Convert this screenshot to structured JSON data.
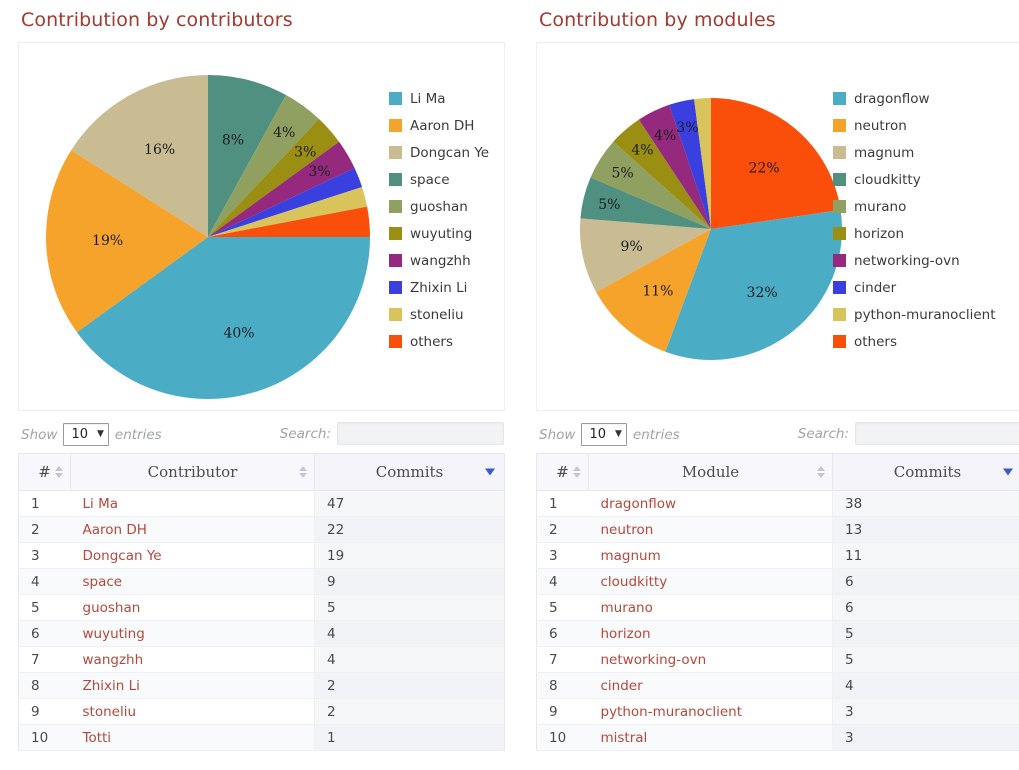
{
  "colors": {
    "title": "#a3392f",
    "link": "#b5483c",
    "sort_active": "#3a5cc8",
    "palette": [
      "#4BACC6",
      "#F5A32B",
      "#C9BC93",
      "#4F9080",
      "#8FA060",
      "#9A8F12",
      "#95297E",
      "#3A3FE0",
      "#D8C45B",
      "#FA4F0A"
    ]
  },
  "panels": [
    {
      "title": "Contribution by contributors",
      "chart_data": {
        "type": "pie",
        "title": "Contribution by contributors",
        "legend_position": "right",
        "unit": "percent",
        "start_angle_deg": 0,
        "direction": "clockwise",
        "labels": [
          "space",
          "guoshan",
          "wuyuting",
          "wangzhh",
          "Zhixin Li",
          "stoneliu",
          "others",
          "Li Ma",
          "Aaron DH",
          "Dongcan Ye"
        ],
        "values": [
          8,
          4,
          3,
          3,
          2,
          2,
          3,
          40,
          19,
          16
        ],
        "shown_labels": [
          "8%",
          "4%",
          "3%",
          "3%",
          "",
          "",
          "",
          "40%",
          "19%",
          "16%"
        ],
        "colors": [
          "#4F9080",
          "#8FA060",
          "#9A8F12",
          "#95297E",
          "#3A3FE0",
          "#D8C45B",
          "#FA4F0A",
          "#4BACC6",
          "#F5A32B",
          "#C9BC93"
        ],
        "legend": [
          {
            "label": "Li Ma",
            "color": "#4BACC6"
          },
          {
            "label": "Aaron DH",
            "color": "#F5A32B"
          },
          {
            "label": "Dongcan Ye",
            "color": "#C9BC93"
          },
          {
            "label": "space",
            "color": "#4F9080"
          },
          {
            "label": "guoshan",
            "color": "#8FA060"
          },
          {
            "label": "wuyuting",
            "color": "#9A8F12"
          },
          {
            "label": "wangzhh",
            "color": "#95297E"
          },
          {
            "label": "Zhixin Li",
            "color": "#3A3FE0"
          },
          {
            "label": "stoneliu",
            "color": "#D8C45B"
          },
          {
            "label": "others",
            "color": "#FA4F0A"
          }
        ]
      },
      "controls": {
        "show_label": "Show",
        "entries_value": "10",
        "entries_label": "entries",
        "search_label": "Search:",
        "search_value": "",
        "search_placeholder": ""
      },
      "table": {
        "columns": [
          "#",
          "Contributor",
          "Commits"
        ],
        "sorted_column": "Commits",
        "sort_direction": "desc",
        "rows": [
          {
            "idx": "1",
            "name": "Li Ma",
            "commits": "47"
          },
          {
            "idx": "2",
            "name": "Aaron DH",
            "commits": "22"
          },
          {
            "idx": "3",
            "name": "Dongcan Ye",
            "commits": "19"
          },
          {
            "idx": "4",
            "name": "space",
            "commits": "9"
          },
          {
            "idx": "5",
            "name": "guoshan",
            "commits": "5"
          },
          {
            "idx": "6",
            "name": "wuyuting",
            "commits": "4"
          },
          {
            "idx": "7",
            "name": "wangzhh",
            "commits": "4"
          },
          {
            "idx": "8",
            "name": "Zhixin Li",
            "commits": "2"
          },
          {
            "idx": "9",
            "name": "stoneliu",
            "commits": "2"
          },
          {
            "idx": "10",
            "name": "Totti",
            "commits": "1"
          }
        ]
      }
    },
    {
      "title": "Contribution by modules",
      "chart_data": {
        "type": "pie",
        "title": "Contribution by modules",
        "legend_position": "right",
        "unit": "percent",
        "start_angle_deg": 0,
        "direction": "clockwise",
        "labels": [
          "others",
          "dragonflow",
          "neutron",
          "magnum",
          "cloudkitty",
          "murano",
          "horizon",
          "networking-ovn",
          "cinder",
          "python-muranoclient"
        ],
        "values": [
          22,
          32,
          11,
          9,
          5,
          5,
          4,
          4,
          3,
          2
        ],
        "shown_labels": [
          "22%",
          "32%",
          "11%",
          "9%",
          "5%",
          "5%",
          "4%",
          "4%",
          "3%",
          ""
        ],
        "colors": [
          "#FA4F0A",
          "#4BACC6",
          "#F5A32B",
          "#C9BC93",
          "#4F9080",
          "#8FA060",
          "#9A8F12",
          "#95297E",
          "#3A3FE0",
          "#D8C45B"
        ],
        "legend": [
          {
            "label": "dragonflow",
            "color": "#4BACC6"
          },
          {
            "label": "neutron",
            "color": "#F5A32B"
          },
          {
            "label": "magnum",
            "color": "#C9BC93"
          },
          {
            "label": "cloudkitty",
            "color": "#4F9080"
          },
          {
            "label": "murano",
            "color": "#8FA060"
          },
          {
            "label": "horizon",
            "color": "#9A8F12"
          },
          {
            "label": "networking-ovn",
            "color": "#95297E"
          },
          {
            "label": "cinder",
            "color": "#3A3FE0"
          },
          {
            "label": "python-muranoclient",
            "color": "#D8C45B"
          },
          {
            "label": "others",
            "color": "#FA4F0A"
          }
        ]
      },
      "controls": {
        "show_label": "Show",
        "entries_value": "10",
        "entries_label": "entries",
        "search_label": "Search:",
        "search_value": "",
        "search_placeholder": ""
      },
      "table": {
        "columns": [
          "#",
          "Module",
          "Commits"
        ],
        "sorted_column": "Commits",
        "sort_direction": "desc",
        "rows": [
          {
            "idx": "1",
            "name": "dragonflow",
            "commits": "38"
          },
          {
            "idx": "2",
            "name": "neutron",
            "commits": "13"
          },
          {
            "idx": "3",
            "name": "magnum",
            "commits": "11"
          },
          {
            "idx": "4",
            "name": "cloudkitty",
            "commits": "6"
          },
          {
            "idx": "5",
            "name": "murano",
            "commits": "6"
          },
          {
            "idx": "6",
            "name": "horizon",
            "commits": "5"
          },
          {
            "idx": "7",
            "name": "networking-ovn",
            "commits": "5"
          },
          {
            "idx": "8",
            "name": "cinder",
            "commits": "4"
          },
          {
            "idx": "9",
            "name": "python-muranoclient",
            "commits": "3"
          },
          {
            "idx": "10",
            "name": "mistral",
            "commits": "3"
          }
        ]
      }
    }
  ]
}
